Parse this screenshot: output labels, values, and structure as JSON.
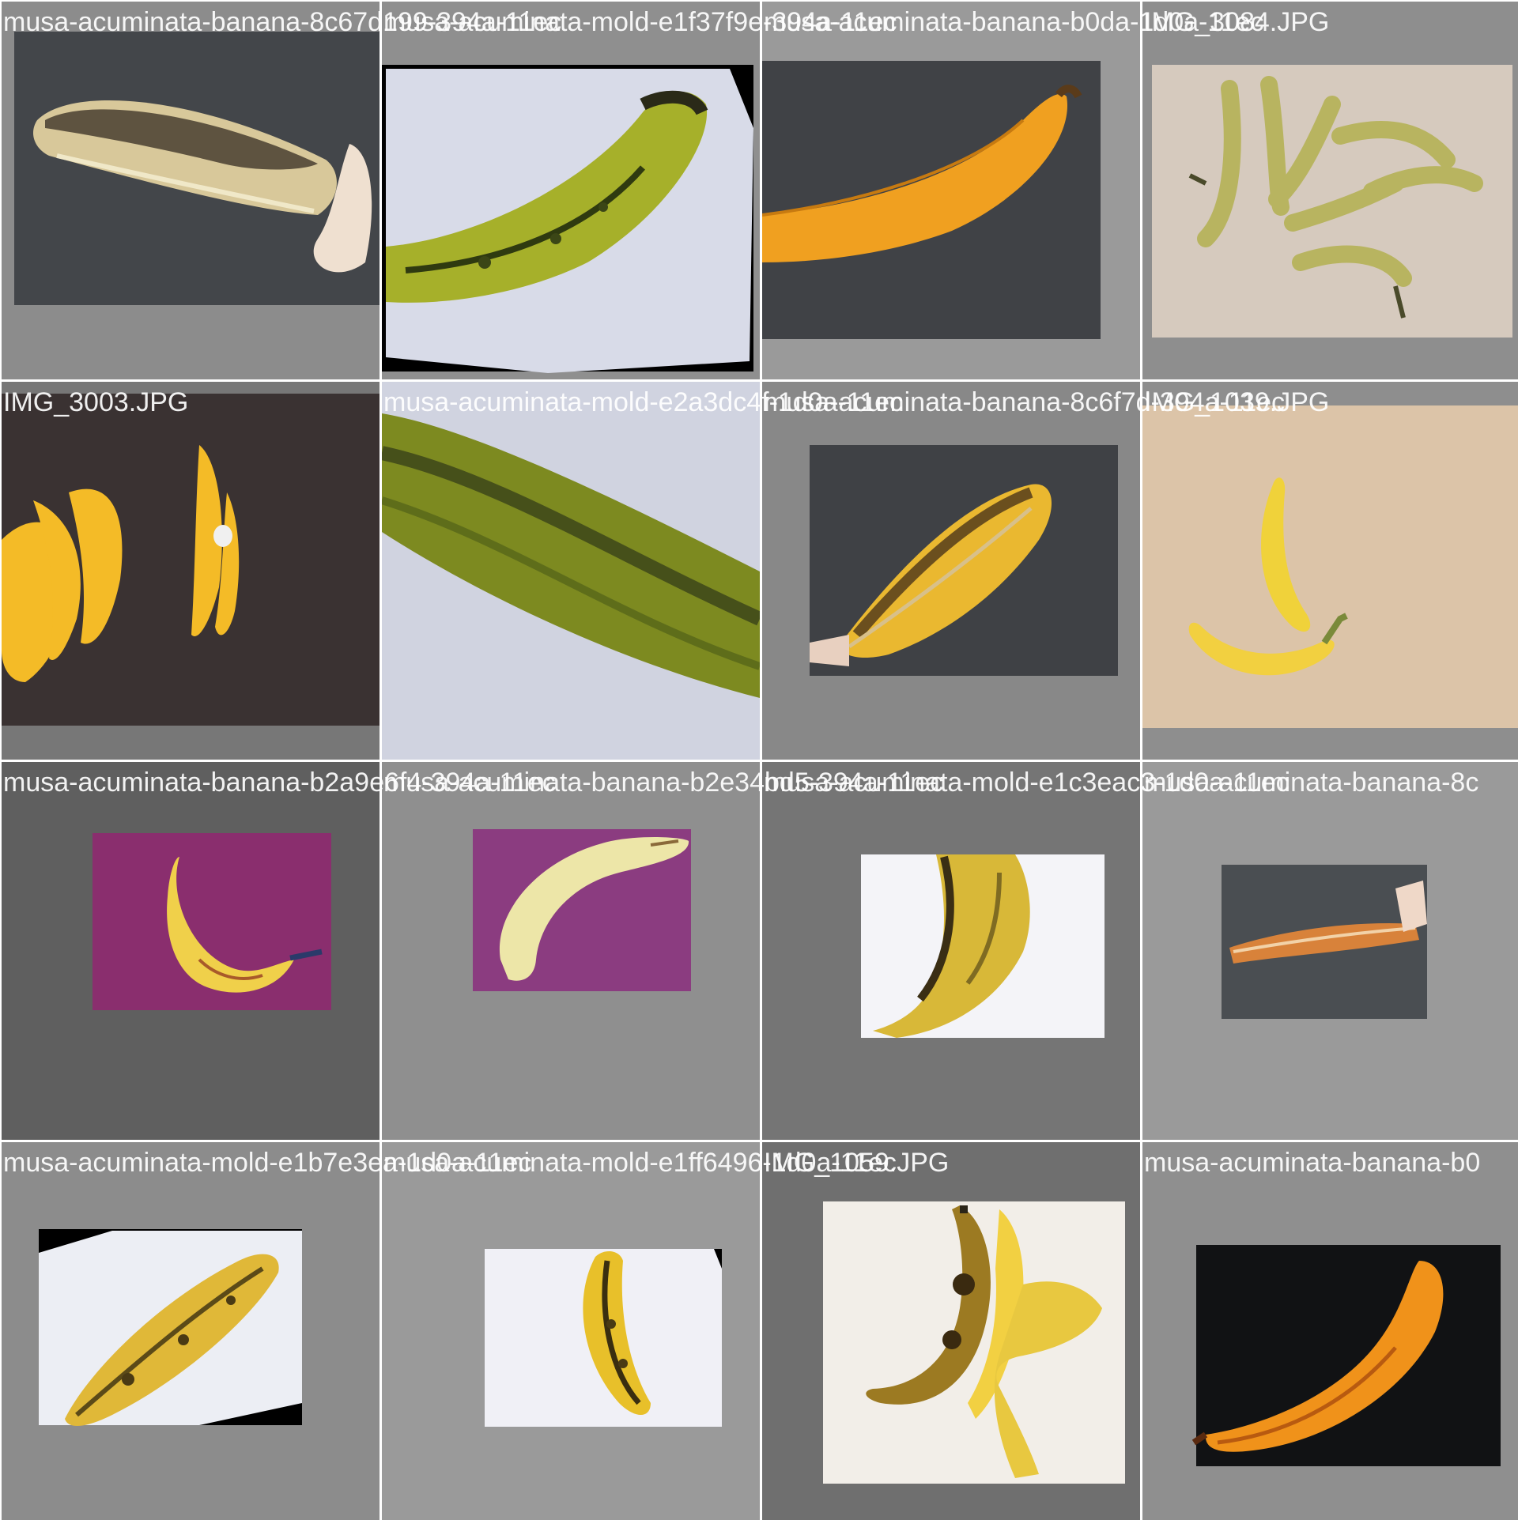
{
  "tiles": [
    {
      "caption": "musa-acuminata-banana-8c67d199-394a-11ec",
      "subject": "peeled-blackened-banana",
      "bg": "#8c8c8c"
    },
    {
      "caption": "musa-acuminata-mold-e1f37f9e-394a-11ec",
      "subject": "green-spotted-banana",
      "bg": "#8f8f8f"
    },
    {
      "caption": "musa-acuminata-banana-b0da-1d0a-11ec",
      "subject": "orange-banana",
      "bg": "#9a9a9a"
    },
    {
      "caption": "IMG_3084.JPG",
      "subject": "banana-bunch-wood",
      "bg": "#8e8e8e"
    },
    {
      "caption": "IMG_3003.JPG",
      "subject": "banana-bunches-dark-cloth",
      "bg": "#777777"
    },
    {
      "caption": "musa-acuminata-mold-e2a3dc4f-1d0a-11ec",
      "subject": "banana-closeup-blurry",
      "bg": "#8c8c8c"
    },
    {
      "caption": "musa-acuminata-banana-8c6f7d-394a-11ec",
      "subject": "peeled-banana-gray",
      "bg": "#888888"
    },
    {
      "caption": "IMG_1039.JPG",
      "subject": "two-bananas-wood",
      "bg": "#8e8e8e"
    },
    {
      "caption": "musa-acuminata-banana-b2a9e6f4-394a-11ec",
      "subject": "banana-purple-bg",
      "bg": "#5f5f5f"
    },
    {
      "caption": "musa-acuminata-banana-b2e34bd5-394a-11ec",
      "subject": "pale-banana-purple-bg",
      "bg": "#8f8f8f"
    },
    {
      "caption": "musa-acuminata-mold-e1c3eac3-1d0a-11ec",
      "subject": "banana-white-bg",
      "bg": "#757575"
    },
    {
      "caption": "musa-acuminata-banana-8c",
      "subject": "peeled-banana-small",
      "bg": "#9a9a9a"
    },
    {
      "caption": "musa-acuminata-mold-e1b7e3ea-1d0a-11ec",
      "subject": "spotted-banana-white",
      "bg": "#8c8c8c"
    },
    {
      "caption": "musa-acuminata-mold-e1ff6496-1d0a-11ec",
      "subject": "spotted-banana-upright",
      "bg": "#9a9a9a"
    },
    {
      "caption": "IMG_1059.JPG",
      "subject": "two-bananas-white",
      "bg": "#6f6f6f"
    },
    {
      "caption": "musa-acuminata-banana-b0",
      "subject": "orange-banana-dark",
      "bg": "#8f8f8f"
    }
  ]
}
